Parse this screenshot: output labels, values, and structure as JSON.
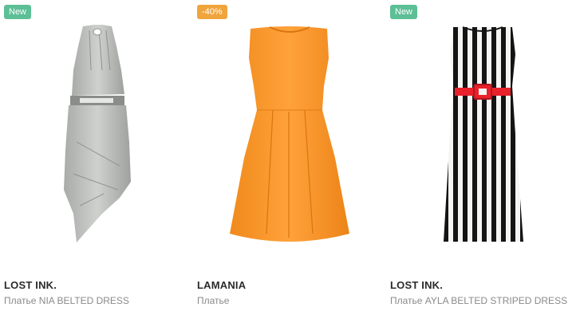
{
  "products": [
    {
      "badge": "New",
      "badge_color": "#5cbf96",
      "brand": "LOST INK.",
      "title": "Платье NIA BELTED DRESS",
      "image_icon": "gray-belted-dress-image"
    },
    {
      "badge": "-40%",
      "badge_color": "#f0a43c",
      "brand": "LAMANIA",
      "title": "Платье",
      "image_icon": "orange-dress-image"
    },
    {
      "badge": "New",
      "badge_color": "#5cbf96",
      "brand": "LOST INK.",
      "title": "Платье AYLA BELTED STRIPED DRESS",
      "image_icon": "striped-belted-dress-image"
    }
  ]
}
